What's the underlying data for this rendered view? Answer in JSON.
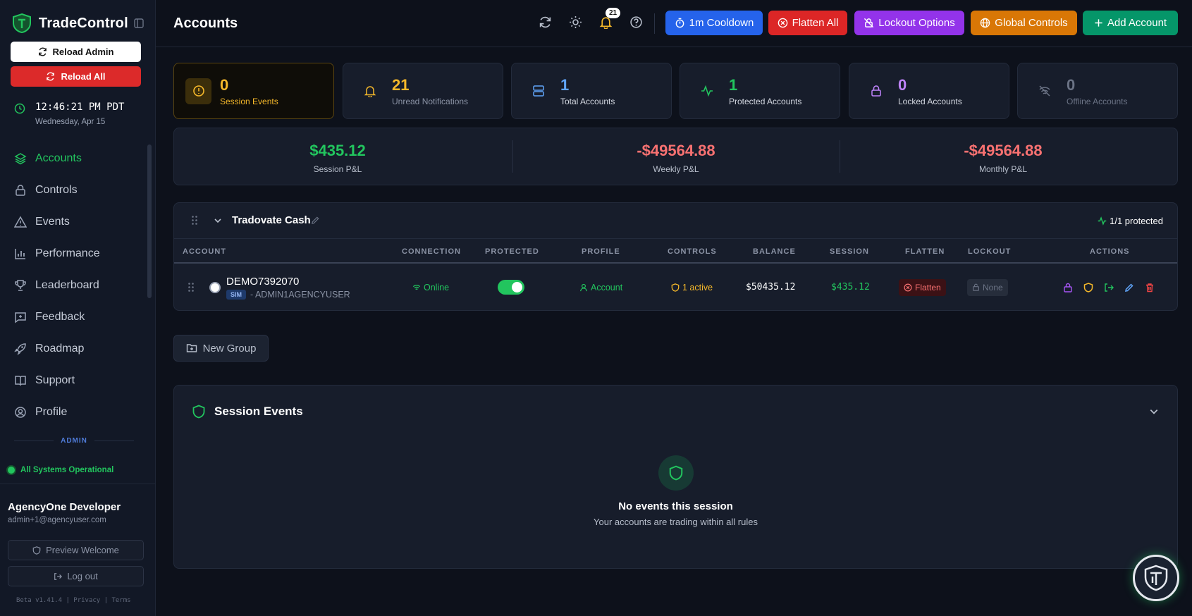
{
  "brand": {
    "name": "TradeControl"
  },
  "sidebar": {
    "reload_admin": "Reload Admin",
    "reload_all": "Reload All",
    "clock_time": "12:46:21 PM PDT",
    "clock_date": "Wednesday, Apr 15",
    "nav": [
      {
        "label": "Accounts",
        "icon": "layers-icon",
        "active": true
      },
      {
        "label": "Controls",
        "icon": "lock-icon"
      },
      {
        "label": "Events",
        "icon": "warning-icon"
      },
      {
        "label": "Performance",
        "icon": "bar-chart-icon"
      },
      {
        "label": "Leaderboard",
        "icon": "trophy-icon"
      },
      {
        "label": "Feedback",
        "icon": "message-icon"
      },
      {
        "label": "Roadmap",
        "icon": "rocket-icon"
      },
      {
        "label": "Support",
        "icon": "book-icon"
      },
      {
        "label": "Profile",
        "icon": "user-circle-icon"
      }
    ],
    "admin_label": "ADMIN",
    "system_status": "All Systems Operational",
    "user_name": "AgencyOne Developer",
    "user_email": "admin+1@agencyuser.com",
    "preview_welcome": "Preview Welcome",
    "logout": "Log out",
    "footer": "Beta v1.41.4 | Privacy | Terms"
  },
  "header": {
    "title": "Accounts",
    "notification_count": "21",
    "buttons": {
      "cooldown": "1m Cooldown",
      "flatten_all": "Flatten All",
      "lockout_options": "Lockout Options",
      "global_controls": "Global Controls",
      "add_account": "Add Account"
    }
  },
  "stats": [
    {
      "value": "0",
      "label": "Session Events",
      "color": "#f5b82a"
    },
    {
      "value": "21",
      "label": "Unread Notifications",
      "color": "#f5b82a"
    },
    {
      "value": "1",
      "label": "Total Accounts",
      "color": "#60a5fa"
    },
    {
      "value": "1",
      "label": "Protected Accounts",
      "color": "#22c55e"
    },
    {
      "value": "0",
      "label": "Locked Accounts",
      "color": "#c084fc"
    },
    {
      "value": "0",
      "label": "Offline Accounts",
      "color": "#6b7385"
    }
  ],
  "pnl": {
    "session": {
      "value": "$435.12",
      "label": "Session P&L"
    },
    "weekly": {
      "value": "-$49564.88",
      "label": "Weekly P&L"
    },
    "monthly": {
      "value": "-$49564.88",
      "label": "Monthly P&L"
    }
  },
  "group": {
    "name": "Tradovate Cash",
    "protected_summary": "1/1 protected",
    "columns": [
      "ACCOUNT",
      "CONNECTION",
      "PROTECTED",
      "PROFILE",
      "CONTROLS",
      "BALANCE",
      "SESSION",
      "FLATTEN",
      "LOCKOUT",
      "ACTIONS"
    ],
    "row": {
      "account": "DEMO7392070",
      "type": "SIM",
      "user": "- ADMIN1AGENCYUSER",
      "connection": "Online",
      "profile": "Account",
      "controls": "1 active",
      "balance": "$50435.12",
      "session": "$435.12",
      "flatten": "Flatten",
      "lockout": "None"
    }
  },
  "new_group": "New Group",
  "events": {
    "title": "Session Events",
    "empty_title": "No events this session",
    "empty_sub": "Your accounts are trading within all rules"
  }
}
